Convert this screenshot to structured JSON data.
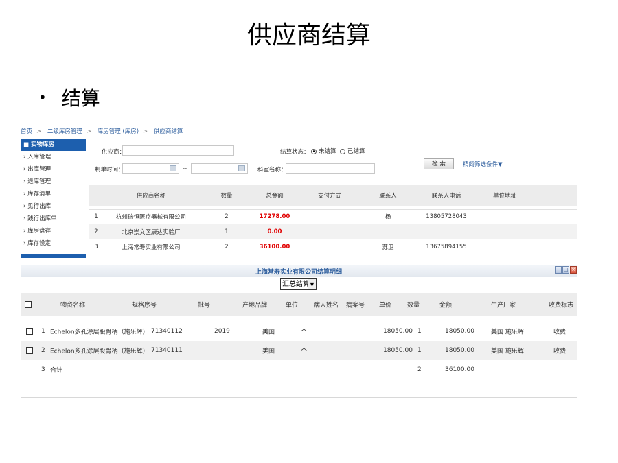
{
  "slide": {
    "title": "供应商结算",
    "bullet": "结算"
  },
  "breadcrumb": [
    "首页",
    "二级库房管理",
    "库房管理 (库房)",
    "供应商结算"
  ],
  "sidebar": {
    "header": "实物库房",
    "items": [
      "入库管理",
      "出库管理",
      "退库管理",
      "库存清单",
      "见行出库",
      "践行出库单",
      "库房盘存",
      "库存设定"
    ]
  },
  "filter": {
    "supplier_label": "供应商：",
    "status_label": "结算状态：",
    "status_options": [
      "未结算",
      "已结算"
    ],
    "search_button": "检 索",
    "advanced_link": "精简筛选条件▼",
    "date_label": "制单时间：",
    "date_sep": "--",
    "dept_label": "科室名称："
  },
  "supplier_table": {
    "columns": [
      "供应商名称",
      "数量",
      "总金额",
      "支付方式",
      "联系人",
      "联系人电话",
      "单位地址"
    ],
    "rows": [
      {
        "idx": "1",
        "name": "杭州瑞恒医疗器械有限公司",
        "qty": "2",
        "amount": "17278.00",
        "pay": "",
        "contact": "杨",
        "phone": "13805728043",
        "address": ""
      },
      {
        "idx": "2",
        "name": "北京崇文区康达实验厂",
        "qty": "1",
        "amount": "0.00",
        "pay": "",
        "contact": "",
        "phone": "",
        "address": ""
      },
      {
        "idx": "3",
        "name": "上海常寿实业有限公司",
        "qty": "2",
        "amount": "36100.00",
        "pay": "",
        "contact": "苏卫",
        "phone": "13675894155",
        "address": ""
      }
    ]
  },
  "detail": {
    "title": "上海常寿实业有限公司结算明细",
    "select_value": "汇总结算",
    "columns": [
      "物资名称",
      "规格序号",
      "批号",
      "产地品牌",
      "单位",
      "病人姓名",
      "病案号",
      "单价",
      "数量",
      "金额",
      "生产厂家",
      "收费标志"
    ],
    "rows": [
      {
        "idx": "1",
        "name": "Echelon多孔涂层股骨柄（施乐辉）",
        "spec": "71340112",
        "batch": "2019",
        "origin": "美国",
        "unit": "个",
        "patient": "",
        "case": "",
        "price": "18050.00",
        "qty": "1",
        "amount": "18050.00",
        "maker": "美国 施乐辉",
        "charge": "收费"
      },
      {
        "idx": "2",
        "name": "Echelon多孔涂层股骨柄（施乐辉）",
        "spec": "71340111",
        "batch": "",
        "origin": "美国",
        "unit": "个",
        "patient": "",
        "case": "",
        "price": "18050.00",
        "qty": "1",
        "amount": "18050.00",
        "maker": "美国 施乐辉",
        "charge": "收费"
      }
    ],
    "total": {
      "idx": "3",
      "label": "合计",
      "qty": "2",
      "amount": "36100.00"
    }
  },
  "colors": {
    "nav_blue": "#1d5fae",
    "link_blue": "#2f5f9e",
    "amount_red": "#e00000"
  }
}
